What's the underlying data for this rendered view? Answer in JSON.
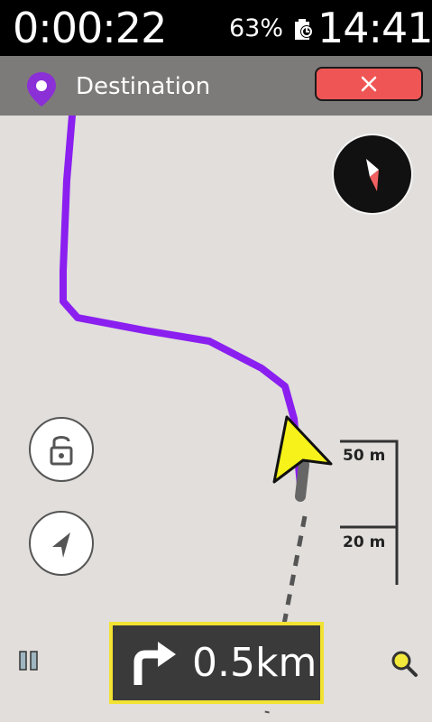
{
  "status_bar": {
    "timer": "0:00:22",
    "battery": "63%",
    "clock": "14:41"
  },
  "destination_bar": {
    "label": "Destination",
    "close_icon": "close-icon",
    "close_color": "#ef5555"
  },
  "map": {
    "route_color": "#8a1ff0",
    "scale": {
      "upper": "50 m",
      "lower": "20 m"
    }
  },
  "controls": {
    "lock_icon": "lock-icon",
    "locate_icon": "locate-icon",
    "pause_icon": "pause-icon",
    "search_icon": "search-icon",
    "compass_icon": "compass-icon"
  },
  "navigation": {
    "turn_icon": "turn-right-icon",
    "distance": "0.5km",
    "panel_border_color": "#f2e232"
  }
}
